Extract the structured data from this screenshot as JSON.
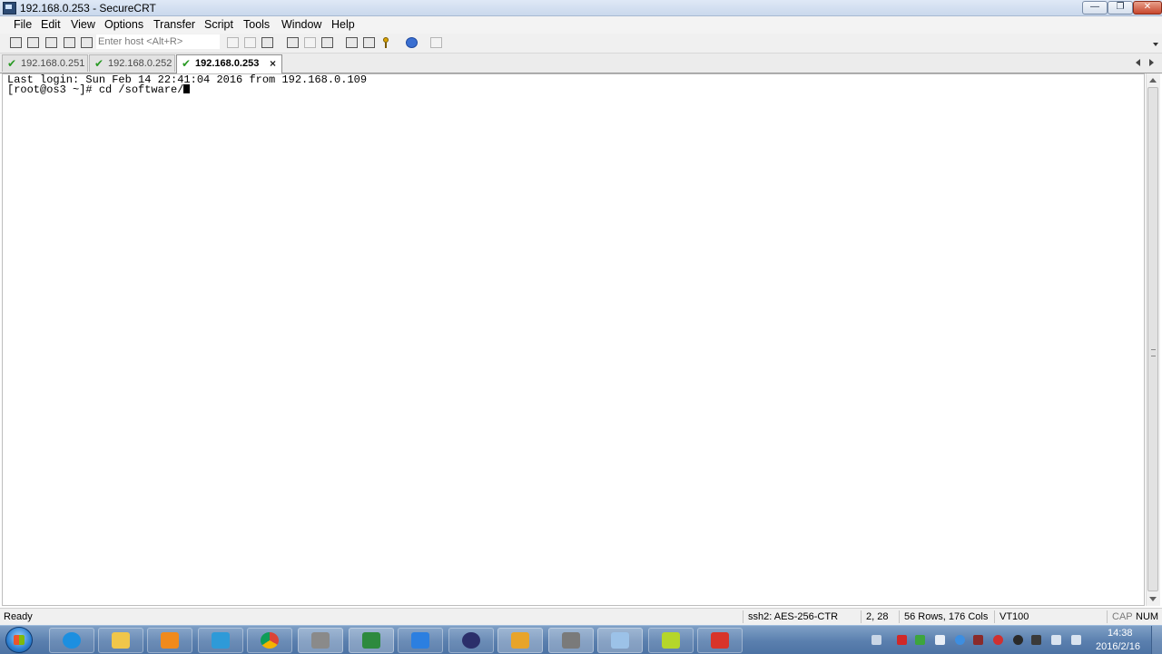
{
  "window": {
    "title": "192.168.0.253 - SecureCRT",
    "min_glyph": "—",
    "max_glyph": "❐",
    "close_glyph": "✕"
  },
  "menu": [
    "File",
    "Edit",
    "View",
    "Options",
    "Transfer",
    "Script",
    "Tools",
    "Window",
    "Help"
  ],
  "toolbar": {
    "host_placeholder": "Enter host <Alt+R>"
  },
  "tabs": [
    {
      "label": "192.168.0.251",
      "active": false
    },
    {
      "label": "192.168.0.252",
      "active": false
    },
    {
      "label": "192.168.0.253",
      "active": true
    }
  ],
  "tab_close_glyph": "×",
  "terminal": {
    "lines": [
      "Last login: Sun Feb 14 22:41:04 2016 from 192.168.0.109",
      "[root@os3 ~]# cd /software/"
    ]
  },
  "status": {
    "ready": "Ready",
    "cipher": "ssh2: AES-256-CTR",
    "position": "2,  28",
    "size": "56 Rows, 176 Cols",
    "emulation": "VT100",
    "caps": "CAP",
    "num": "NUM"
  },
  "taskbar": {
    "time": "14:38",
    "date": "2016/2/16"
  },
  "colors": {
    "taskbar": "#5a7fae",
    "check_green": "#2a9a25"
  }
}
